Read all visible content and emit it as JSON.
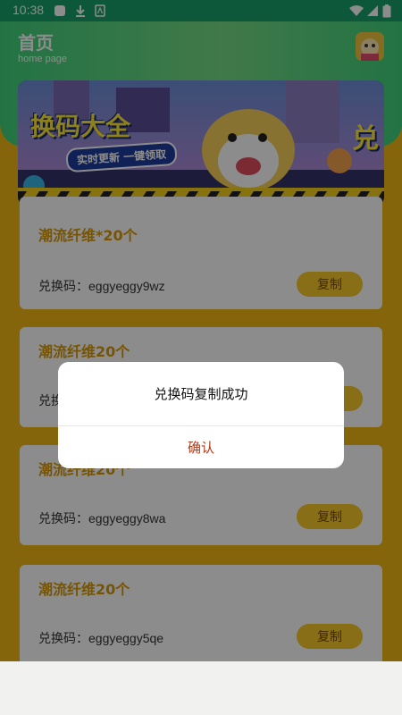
{
  "status_bar": {
    "time": "10:38"
  },
  "header": {
    "title": "首页",
    "subtitle": "home page"
  },
  "banner": {
    "title": "换码大全",
    "tag": "实时更新 一键领取",
    "edge_text": "兑"
  },
  "cards": [
    {
      "title": "潮流纤维*20个",
      "code_label": "兑换码：",
      "code": "eggyeggy9wz",
      "copy_label": "复制"
    },
    {
      "title": "潮流纤维20个",
      "code_label": "兑换码：",
      "code": "",
      "copy_label": "复制"
    },
    {
      "title": "潮流纤维20个",
      "code_label": "兑换码：",
      "code": "eggyeggy8wa",
      "copy_label": "复制"
    },
    {
      "title": "潮流纤维20个",
      "code_label": "兑换码：",
      "code": "eggyeggy5qe",
      "copy_label": "复制"
    }
  ],
  "dialog": {
    "message": "兑换码复制成功",
    "confirm": "确认"
  },
  "colors": {
    "header_green": "#3fd27c",
    "page_yellow": "#f2b816",
    "card_title": "#d89a08",
    "copy_button": "#f6c92b",
    "confirm_text": "#b33a1a"
  }
}
